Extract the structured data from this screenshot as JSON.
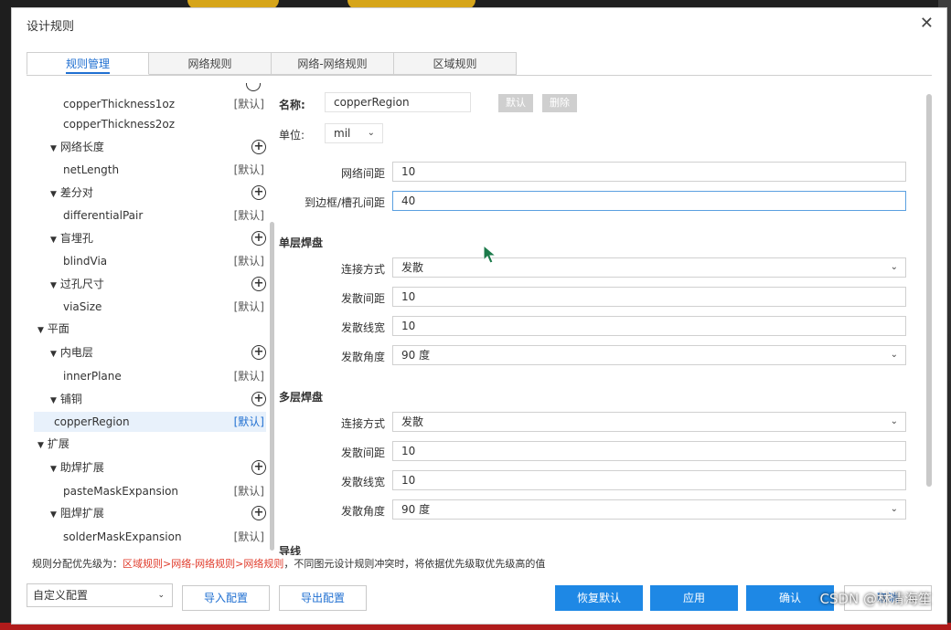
{
  "dialog": {
    "title": "设计规则",
    "close_glyph": "✕"
  },
  "tabs": [
    {
      "label": "规则管理",
      "active": true
    },
    {
      "label": "网络规则",
      "active": false
    },
    {
      "label": "网络-网络规则",
      "active": false
    },
    {
      "label": "区域规则",
      "active": false
    }
  ],
  "tree": {
    "default_tag": "[默认]",
    "items": [
      {
        "label": "copperThickness1oz",
        "tag": "[默认]"
      },
      {
        "label": "copperThickness2oz"
      },
      {
        "label": "网络长度"
      },
      {
        "label": "netLength",
        "tag": "[默认]"
      },
      {
        "label": "差分对"
      },
      {
        "label": "differentialPair",
        "tag": "[默认]"
      },
      {
        "label": "盲埋孔"
      },
      {
        "label": "blindVia",
        "tag": "[默认]"
      },
      {
        "label": "过孔尺寸"
      },
      {
        "label": "viaSize",
        "tag": "[默认]"
      },
      {
        "label": "平面"
      },
      {
        "label": "内电层"
      },
      {
        "label": "innerPlane",
        "tag": "[默认]"
      },
      {
        "label": "铺铜"
      },
      {
        "label": "copperRegion",
        "tag": "[默认]",
        "selected": true
      },
      {
        "label": "扩展"
      },
      {
        "label": "助焊扩展"
      },
      {
        "label": "pasteMaskExpansion",
        "tag": "[默认]"
      },
      {
        "label": "阻焊扩展"
      },
      {
        "label": "solderMaskExpansion",
        "tag": "[默认]"
      }
    ]
  },
  "form": {
    "name_label": "名称:",
    "name_value": "copperRegion",
    "default_button": "默认",
    "delete_button": "删除",
    "unit_label": "单位:",
    "unit_value": "mil",
    "net_spacing_label": "网络间距",
    "net_spacing_value": "10",
    "board_spacing_label": "到边框/槽孔间距",
    "board_spacing_value": "40",
    "single_pad": {
      "title": "单层焊盘",
      "connect_label": "连接方式",
      "connect_value": "发散",
      "spoke_spacing_label": "发散间距",
      "spoke_spacing_value": "10",
      "spoke_width_label": "发散线宽",
      "spoke_width_value": "10",
      "spoke_angle_label": "发散角度",
      "spoke_angle_value": "90 度"
    },
    "multi_pad": {
      "title": "多层焊盘",
      "connect_label": "连接方式",
      "connect_value": "发散",
      "spoke_spacing_label": "发散间距",
      "spoke_spacing_value": "10",
      "spoke_width_label": "发散线宽",
      "spoke_width_value": "10",
      "spoke_angle_label": "发散角度",
      "spoke_angle_value": "90 度"
    },
    "track_title": "导线"
  },
  "footer": {
    "hint_prefix": "规则分配优先级为：",
    "hint_priority": "区域规则>网络-网络规则>网络规则",
    "hint_suffix": "，不同图元设计规则冲突时，将依据优先级取优先级高的值",
    "config_select": "自定义配置",
    "import_button": "导入配置",
    "export_button": "导出配置",
    "restore_button": "恢复默认",
    "apply_button": "应用",
    "confirm_button": "确认",
    "cancel_button": "取消"
  },
  "watermark": "CSDN @林清海笙",
  "colors": {
    "accent": "#1e88e5",
    "priority_red": "#e03b2b",
    "selection": "#e8f1fb"
  }
}
